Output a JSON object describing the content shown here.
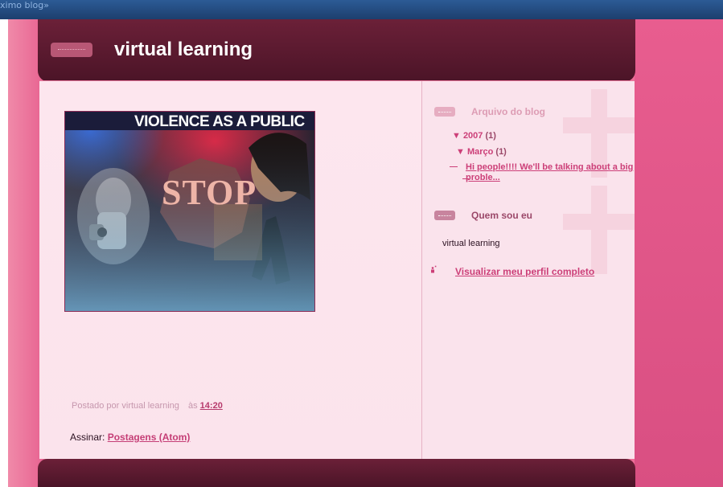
{
  "navbar": {
    "text": "ximo blog»"
  },
  "header": {
    "title": "virtual learning"
  },
  "post": {
    "image_caption": "VIOLENCE AS A PUBLIC",
    "image_sign": "STOP",
    "meta_prefix": "Postado por virtual learning",
    "meta_at": "às",
    "time": "14:20"
  },
  "feed": {
    "label": "Assinar:",
    "link": "Postagens (Atom)"
  },
  "sidebar": {
    "archive_title": "Arquivo do blog",
    "year": "▼ 2007",
    "year_count": "(1)",
    "month": "▼ Março",
    "month_count": "(1)",
    "post_title": "Hi people!!!! We'll be talking about a big proble...",
    "about_title": "Quem sou eu",
    "about_name": "virtual learning",
    "profile_link": "Visualizar meu perfil completo"
  }
}
